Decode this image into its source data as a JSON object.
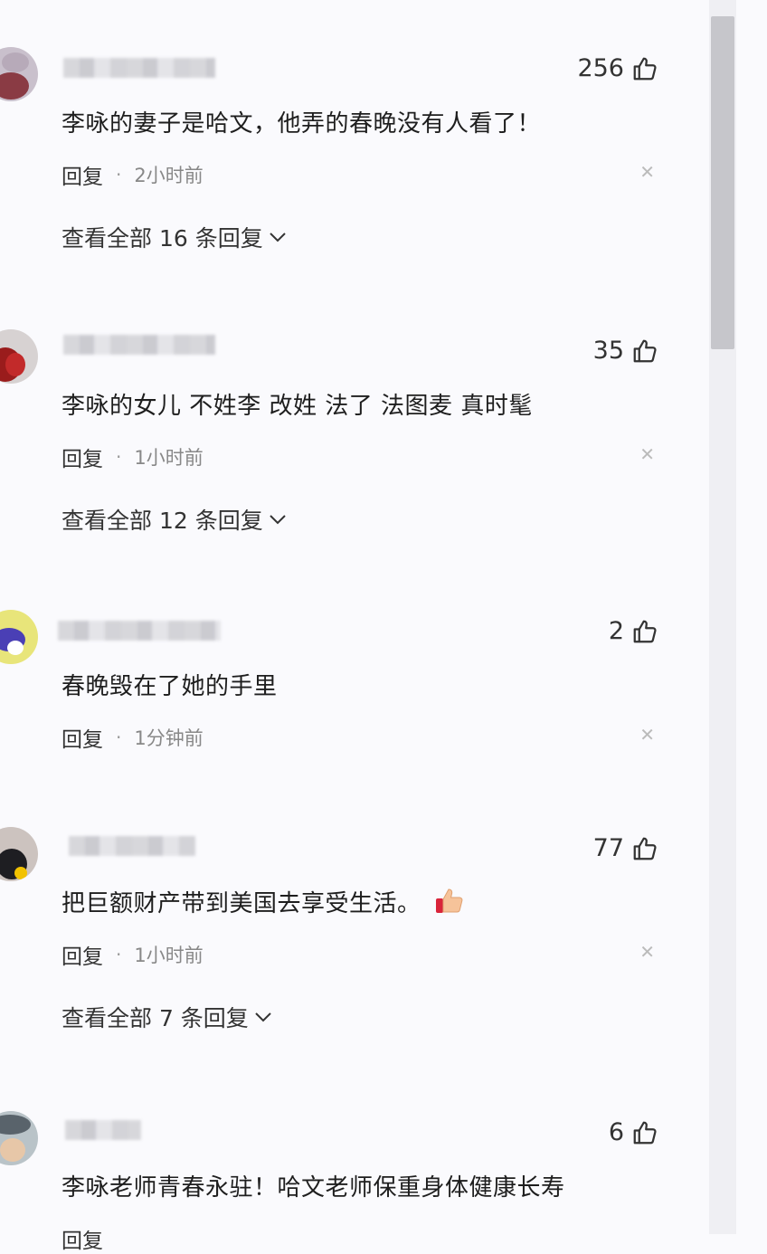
{
  "comments": [
    {
      "likes": "256",
      "text": "李咏的妻子是哈文，他弄的春晚没有人看了！",
      "reply_label": "回复",
      "time": "2小时前",
      "view_all": "查看全部 16 条回复"
    },
    {
      "likes": "35",
      "text": "李咏的女儿 不姓李 改姓 法了 法图麦 真时髦",
      "reply_label": "回复",
      "time": "1小时前",
      "view_all": "查看全部 12 条回复"
    },
    {
      "likes": "2",
      "text": "春晚毁在了她的手里",
      "reply_label": "回复",
      "time": "1分钟前"
    },
    {
      "likes": "77",
      "text": "把巨额财产带到美国去享受生活。",
      "reply_label": "回复",
      "time": "1小时前",
      "view_all": "查看全部 7 条回复"
    },
    {
      "likes": "6",
      "text": "李咏老师青春永驻！哈文老师保重身体健康长寿",
      "reply_label": "回复"
    }
  ],
  "icons": {
    "like": "thumbs-up-icon",
    "close": "close-icon",
    "chevron": "chevron-down-icon",
    "emoji": "thumbs-up-emoji-icon"
  },
  "colors": {
    "background": "#fafafd",
    "scroll_thumb": "#c6c6cb"
  }
}
